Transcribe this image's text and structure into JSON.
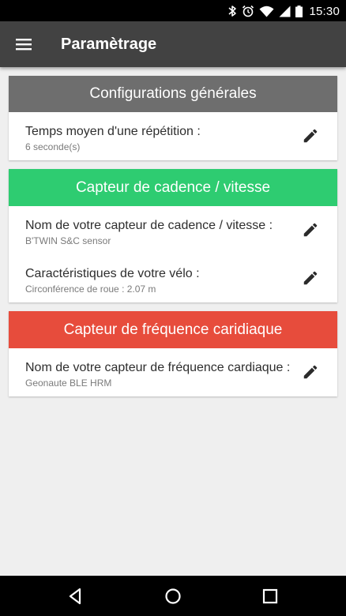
{
  "status_bar": {
    "time": "15:30",
    "icons": [
      "bluetooth-icon",
      "alarm-icon",
      "wifi-icon",
      "cell-signal-icon",
      "battery-icon"
    ]
  },
  "app_bar": {
    "title": "Paramètrage",
    "menu_icon": "hamburger-menu-icon"
  },
  "sections": {
    "general": {
      "title": "Configurations générales",
      "color": "#6e6e6e",
      "items": [
        {
          "label": "Temps moyen d'une répétition :",
          "value": "6 seconde(s)"
        }
      ]
    },
    "cadence": {
      "title": "Capteur de cadence / vitesse",
      "color": "#2ecc71",
      "items": [
        {
          "label": "Nom de votre capteur de cadence / vitesse :",
          "value": "B'TWIN S&C sensor"
        },
        {
          "label": "Caractéristiques de votre vélo :",
          "value": "Circonférence de roue : 2.07 m"
        }
      ]
    },
    "heart": {
      "title": "Capteur de fréquence caridiaque",
      "color": "#e74c3c",
      "items": [
        {
          "label": "Nom de votre capteur de fréquence cardiaque :",
          "value": "Geonaute BLE HRM"
        }
      ]
    }
  },
  "nav_bar": {
    "icons": [
      "back-icon",
      "home-icon",
      "recent-apps-icon"
    ]
  }
}
